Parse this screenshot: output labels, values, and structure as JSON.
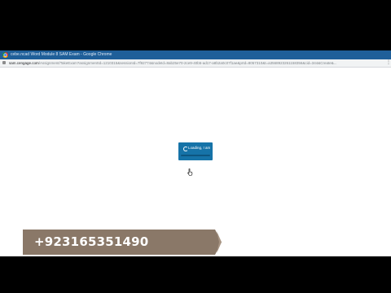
{
  "browser": {
    "window_title": "cebe.ncad Word Module 8 SAM Exam - Google Chrome",
    "url_host": "sam.cengage.com",
    "url_path": "/Assignment/TakeExam?assignmentId=1210315&sessionId=7f92774&nodeId=8ab25e70-2ce9-40b5-ad17-a8b2a0c07f1ae&prId=8057310&t=a3568923261158356&cid=344&Create&..."
  },
  "loading_overlay": {
    "label": "Loading, I am",
    "progress": 0.0
  },
  "banner": {
    "phone": "+923165351490"
  },
  "colors": {
    "title_bar": "#1f5f99",
    "loader_bg": "#1673a8",
    "banner_bg": "#8a7868"
  }
}
